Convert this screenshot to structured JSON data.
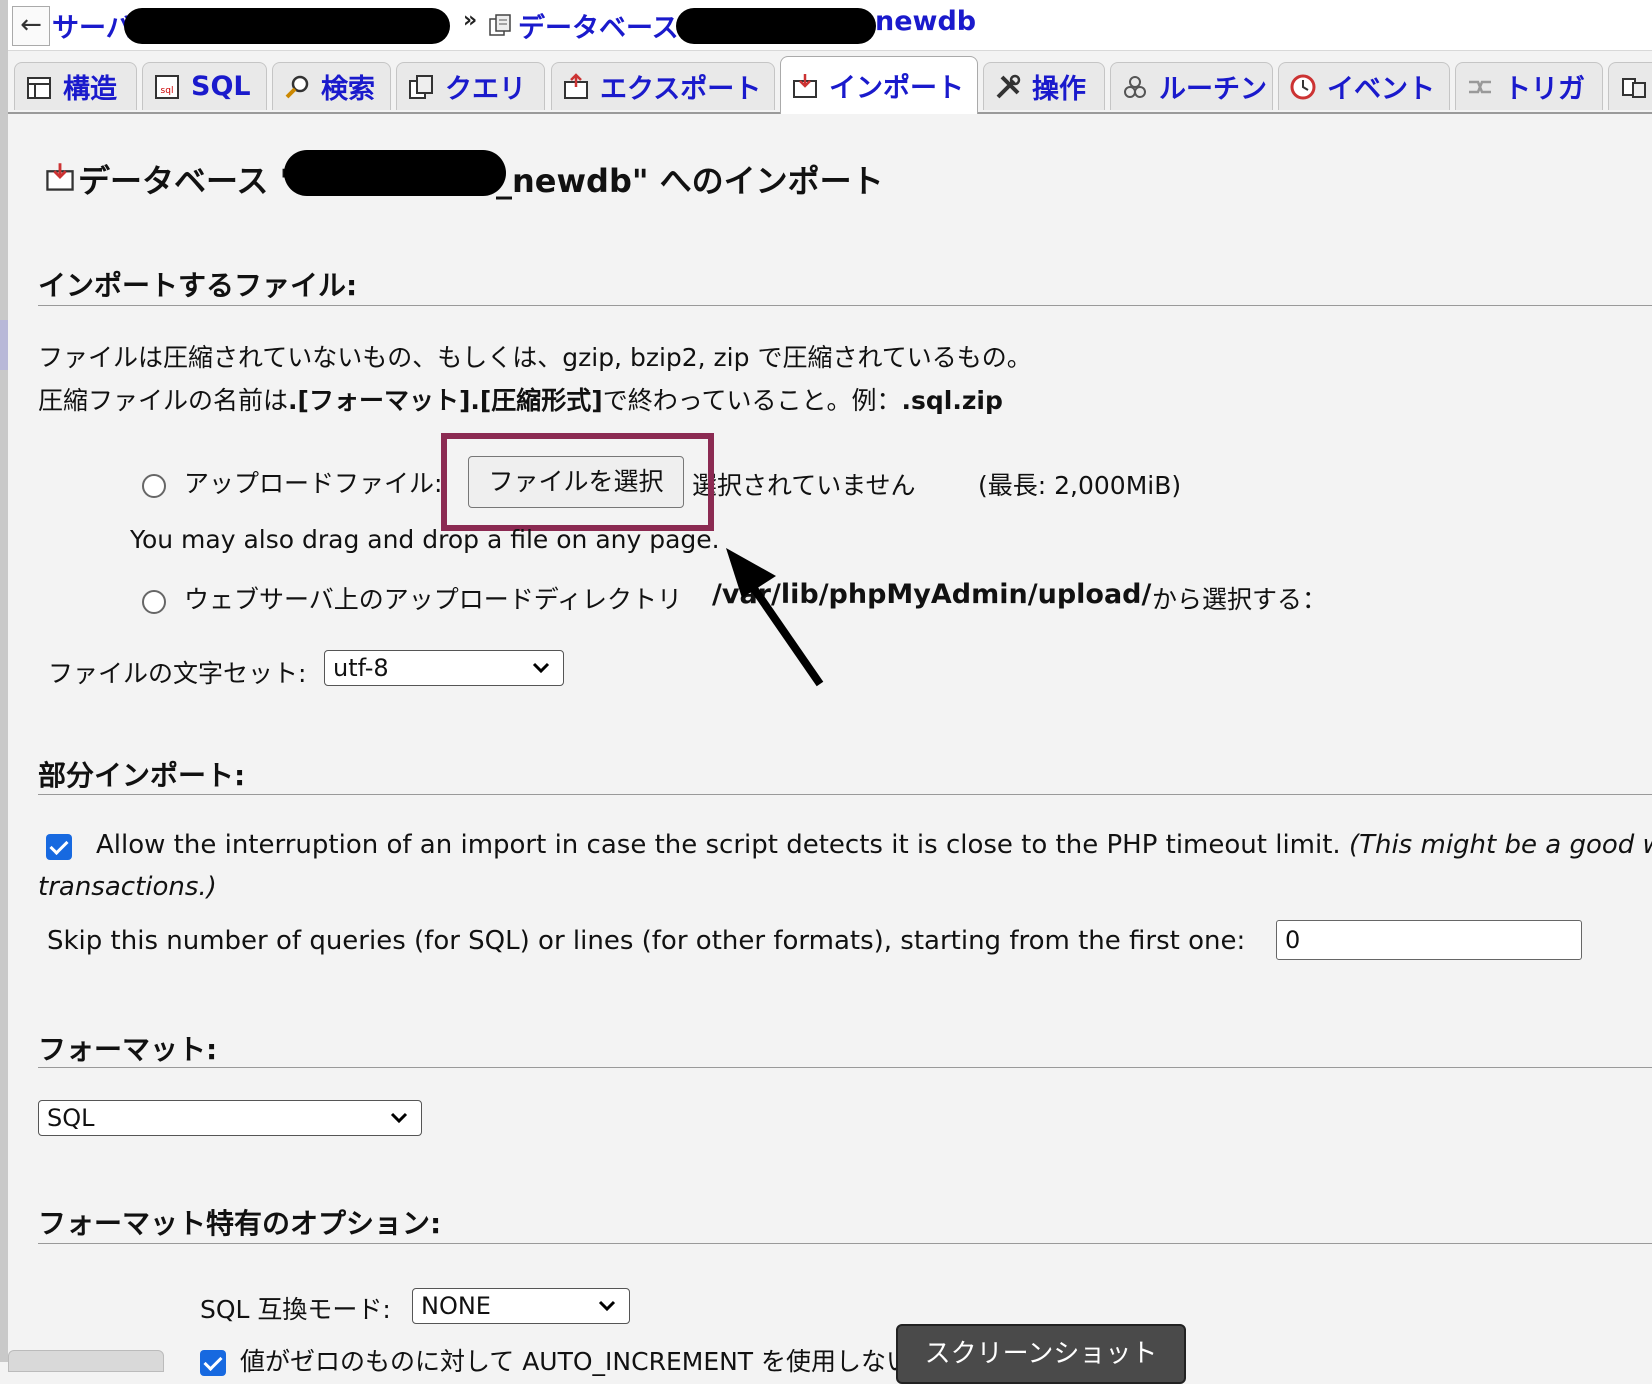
{
  "breadcrumb": {
    "back": "←",
    "server_label": "サーバ:",
    "separator": "»",
    "database_label": "データベース:",
    "database_name_suffix": "newdb"
  },
  "tabs": [
    {
      "label": "構造",
      "icon": "structure-icon"
    },
    {
      "label": "SQL",
      "icon": "sql-icon"
    },
    {
      "label": "検索",
      "icon": "search-icon"
    },
    {
      "label": "クエリ",
      "icon": "query-icon"
    },
    {
      "label": "エクスポート",
      "icon": "export-icon"
    },
    {
      "label": "インポート",
      "icon": "import-icon",
      "active": true
    },
    {
      "label": "操作",
      "icon": "operations-icon"
    },
    {
      "label": "ルーチン",
      "icon": "routines-icon"
    },
    {
      "label": "イベント",
      "icon": "events-icon"
    },
    {
      "label": "トリガ",
      "icon": "triggers-icon"
    }
  ],
  "page": {
    "title_prefix": "データベース \"",
    "title_suffix": "_newdb\" へのインポート"
  },
  "file_section": {
    "heading": "インポートするファイル:",
    "desc_line1": "ファイルは圧縮されていないもの、もしくは、gzip, bzip2, zip で圧縮されているもの。",
    "desc_line2_pre": "圧縮ファイルの名前は",
    "desc_line2_bold": ".[フォーマット].[圧縮形式]",
    "desc_line2_mid": "で終わっていること。例：",
    "desc_line2_example": ".sql.zip",
    "upload_label": "アップロードファイル:",
    "choose_file_button": "ファイルを選択",
    "no_file_selected": "選択されていません",
    "max_size": "(最長: 2,000MiB)",
    "drag_hint": "You may also drag and drop a file on any page.",
    "server_dir_label": "ウェブサーバ上のアップロードディレクトリ",
    "server_dir_path": "/var/lib/phpMyAdmin/upload/",
    "server_dir_suffix": "から選択する：",
    "charset_label": "ファイルの文字セット:",
    "charset_value": "utf-8"
  },
  "partial_section": {
    "heading": "部分インポート:",
    "allow_interrupt_label": "Allow the interruption of an import in case the script detects it is close to the PHP timeout limit.",
    "allow_interrupt_note_line1": "(This might be a good w",
    "allow_interrupt_note_line2": "transactions.)",
    "allow_interrupt_checked": true,
    "skip_label": "Skip this number of queries (for SQL) or lines (for other formats), starting from the first one:",
    "skip_value": "0"
  },
  "format_section": {
    "heading": "フォーマット:",
    "format_value": "SQL"
  },
  "format_options": {
    "heading": "フォーマット特有のオプション:",
    "compat_label": "SQL 互換モード:",
    "compat_value": "NONE",
    "auto_increment_label": "値がゼロのものに対して AUTO_INCREMENT を使用しない",
    "auto_increment_checked": true
  },
  "screenshot_button": "スクリーンショット"
}
